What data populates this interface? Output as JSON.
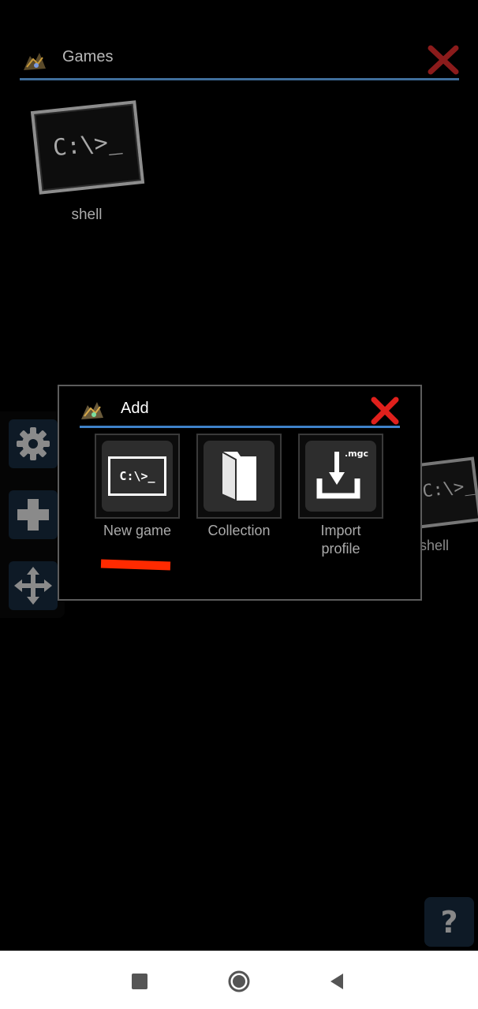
{
  "header": {
    "title": "Games"
  },
  "games": [
    {
      "label": "shell",
      "screen_text": "C:\\>_"
    },
    {
      "label": "shell",
      "screen_text": "C:\\>_"
    }
  ],
  "toolbar": {
    "items": [
      "gear-icon",
      "plus-icon",
      "move-icon"
    ]
  },
  "dialog": {
    "title": "Add",
    "options": [
      {
        "label": "New game",
        "icon_text": "C:\\>_",
        "icon": "terminal-icon"
      },
      {
        "label": "Collection",
        "icon": "folder-icon"
      },
      {
        "label": "Import\nprofile",
        "icon_text": ".mgc",
        "icon": "import-icon"
      }
    ]
  },
  "help": {
    "label": "?"
  },
  "colors": {
    "close_red": "#e0201c",
    "accent_blue": "#3f82c8",
    "marker_red": "#ff2a00"
  }
}
